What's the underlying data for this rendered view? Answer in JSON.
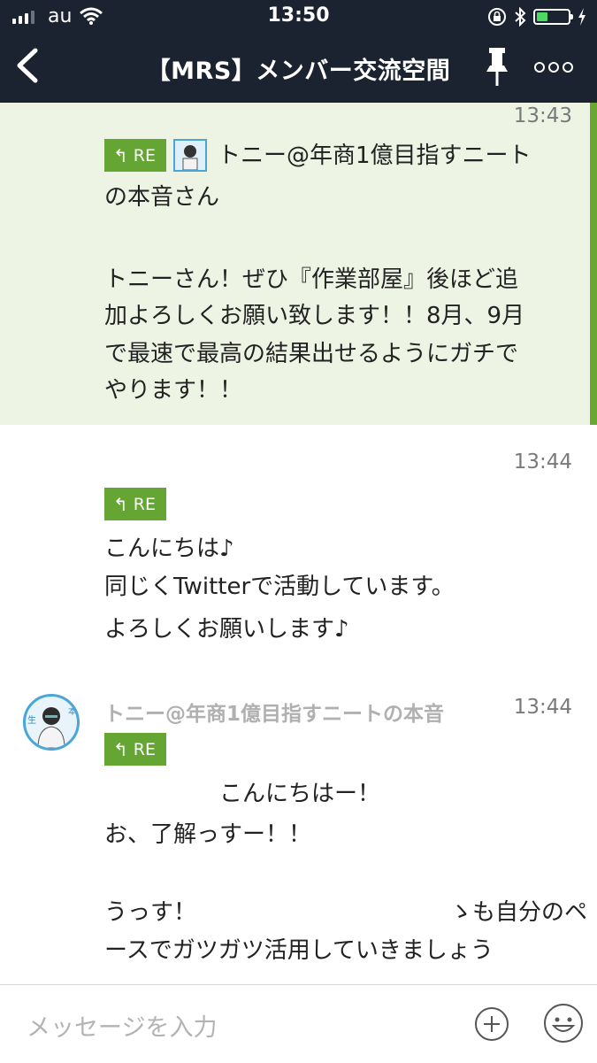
{
  "status": {
    "carrier": "au",
    "time": "13:50",
    "battery_level": 0.35
  },
  "header": {
    "title": "【MRS】メンバー交流空間"
  },
  "messages": [
    {
      "time": "13:43",
      "re_label": "RE",
      "lines": [
        "トニー@年商1億目指すニート",
        "の本音さん",
        "",
        "トニーさん！ぜひ『作業部屋』後ほど追",
        "加よろしくお願い致します！！8月、9月",
        "で最速で最高の結果出せるようにガチで",
        "やります！！"
      ]
    },
    {
      "time": "13:44",
      "re_label": "RE",
      "lines": [
        "こんにちは♪",
        "同じくTwitterで活動しています。",
        "よろしくお願いします♪"
      ]
    },
    {
      "sender": "トニー@年商1億目指すニートの本音",
      "time": "13:44",
      "re_label": "RE",
      "lines": [
        "　　　　　こんにちはー！",
        "お、了解っすー！！",
        "",
        "うっす！　　　　　　　　　　　ゝも自分のペ",
        "ースでガツガツ活用していきましょう"
      ]
    }
  ],
  "input": {
    "placeholder": "メッセージを入力"
  },
  "colors": {
    "header_bg": "#1b2330",
    "re_tag": "#64a533",
    "highlight_bg": "#eef4e4",
    "accent": "#6aa632"
  },
  "icons": [
    "back-chevron-icon",
    "pin-icon",
    "more-icon",
    "plus-icon",
    "emoji-icon",
    "wifi-icon",
    "bluetooth-icon",
    "battery-icon"
  ]
}
